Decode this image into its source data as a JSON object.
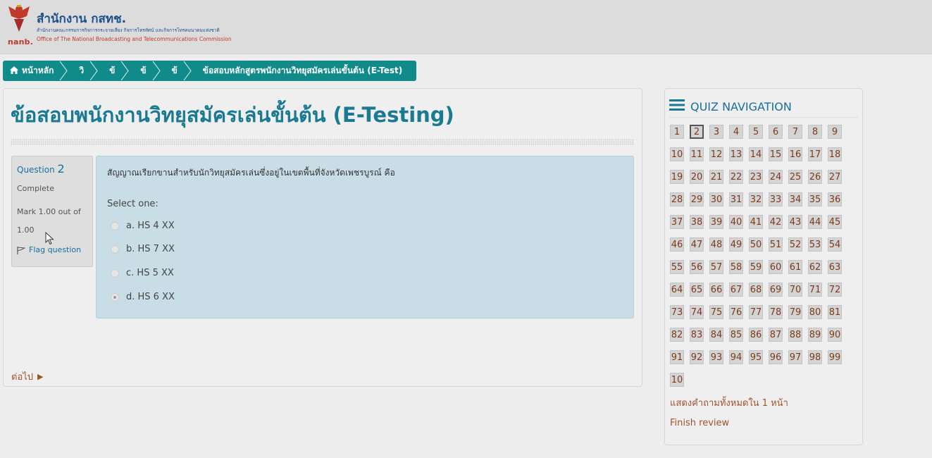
{
  "header": {
    "title": "สำนักงาน กสทช.",
    "sub_thai": "สำนักงานคณะกรรมการกิจการกระจายเสียง กิจการโทรทัศน์ และกิจการโทรคมนาคมแห่งชาติ",
    "sub_english": "Office of The National Broadcasting and Telecommunications Commission",
    "logo_mark": "nanb."
  },
  "breadcrumb": {
    "items": [
      "หน้าหลัก",
      "วิ",
      "ข้",
      "ข้",
      "ข้",
      "ข้อสอบหลักสูตรพนักงานวิทยุสมัครเล่นขั้นต้น (E-Test)"
    ]
  },
  "page": {
    "title": "ข้อสอบพนักงานวิทยุสมัครเล่นขั้นต้น (E-Testing)"
  },
  "question": {
    "label": "Question",
    "number": "2",
    "state": "Complete",
    "mark": "Mark 1.00 out of 1.00",
    "flag_label": "Flag question",
    "text": "สัญญาณเรียกขานสำหรับนักวิทยุสมัครเล่นซึ่งอยู่ในเขตพื้นที่จังหวัดเพชรบูรณ์ คือ",
    "prompt": "Select one:",
    "answers": [
      {
        "label": "a. HS 4 XX",
        "selected": false
      },
      {
        "label": "b. HS 7 XX",
        "selected": false
      },
      {
        "label": "c. HS 5 XX",
        "selected": false
      },
      {
        "label": "d. HS 6 XX",
        "selected": true
      }
    ],
    "next_label": "ต่อไป"
  },
  "quiz_nav": {
    "title": "QUIZ NAVIGATION",
    "current": "2",
    "buttons": [
      "1",
      "2",
      "3",
      "4",
      "5",
      "6",
      "7",
      "8",
      "9",
      "10",
      "11",
      "12",
      "13",
      "14",
      "15",
      "16",
      "17",
      "18",
      "19",
      "20",
      "21",
      "22",
      "23",
      "24",
      "25",
      "26",
      "27",
      "28",
      "29",
      "30",
      "31",
      "32",
      "33",
      "34",
      "35",
      "36",
      "37",
      "38",
      "39",
      "40",
      "41",
      "42",
      "43",
      "44",
      "45",
      "46",
      "47",
      "48",
      "49",
      "50",
      "51",
      "52",
      "53",
      "54",
      "55",
      "56",
      "57",
      "58",
      "59",
      "60",
      "61",
      "62",
      "63",
      "64",
      "65",
      "66",
      "67",
      "68",
      "69",
      "70",
      "71",
      "72",
      "73",
      "74",
      "75",
      "76",
      "77",
      "78",
      "79",
      "80",
      "81",
      "82",
      "83",
      "84",
      "85",
      "86",
      "87",
      "88",
      "89",
      "90",
      "91",
      "92",
      "93",
      "94",
      "95",
      "96",
      "97",
      "98",
      "99",
      "10"
    ],
    "show_all_label": "แสดงคำถามทั้งหมดใน 1 หน้า",
    "finish_label": "Finish review"
  },
  "colors": {
    "accent": "#118a8a",
    "title": "#1a7a92",
    "link": "#a0522d",
    "question_bg": "#c8dde6"
  }
}
